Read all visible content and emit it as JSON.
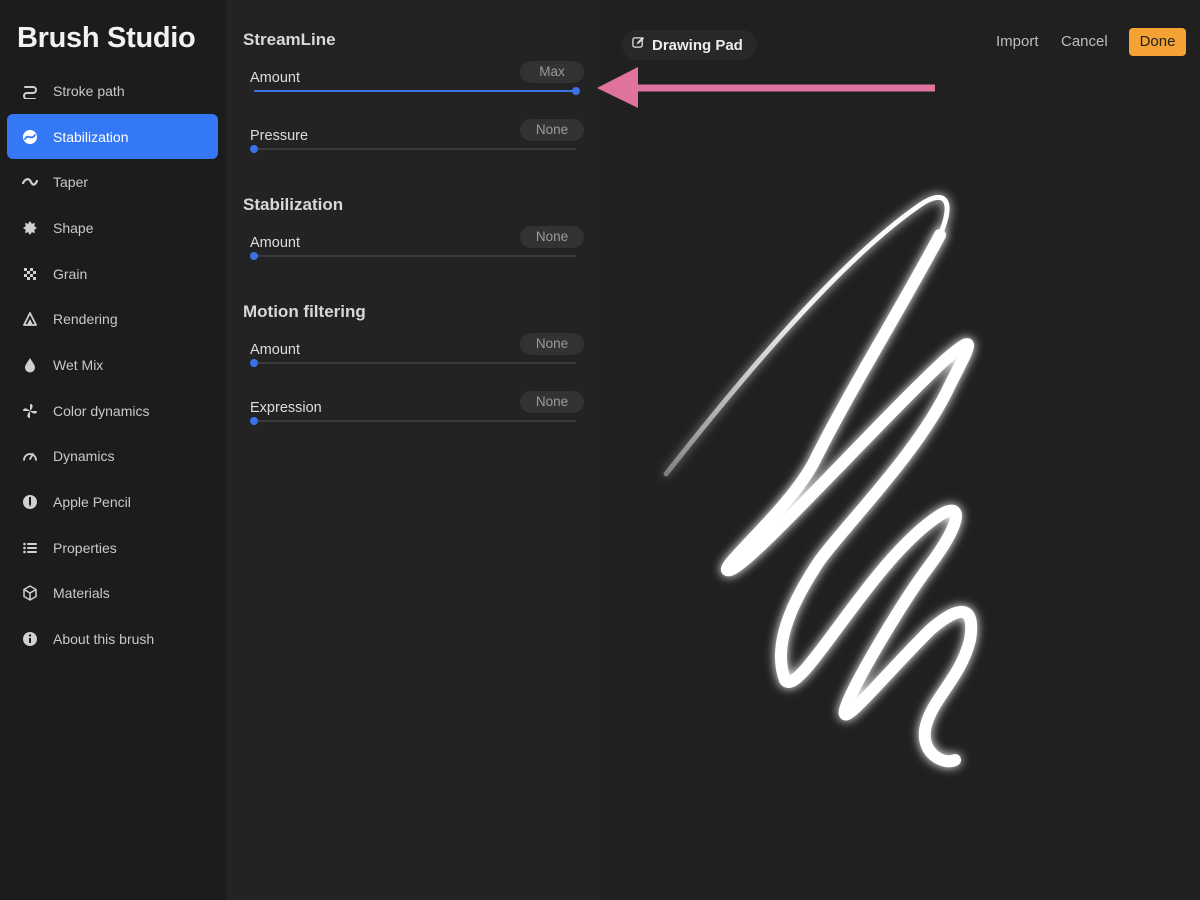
{
  "app": {
    "title": "Brush Studio"
  },
  "sidebar": {
    "items": [
      {
        "label": "Stroke path",
        "icon": "stroke-path-icon",
        "active": false
      },
      {
        "label": "Stabilization",
        "icon": "stabilization-icon",
        "active": true
      },
      {
        "label": "Taper",
        "icon": "taper-icon",
        "active": false
      },
      {
        "label": "Shape",
        "icon": "shape-icon",
        "active": false
      },
      {
        "label": "Grain",
        "icon": "grain-icon",
        "active": false
      },
      {
        "label": "Rendering",
        "icon": "rendering-icon",
        "active": false
      },
      {
        "label": "Wet Mix",
        "icon": "wet-mix-icon",
        "active": false
      },
      {
        "label": "Color dynamics",
        "icon": "color-dynamics-icon",
        "active": false
      },
      {
        "label": "Dynamics",
        "icon": "dynamics-icon",
        "active": false
      },
      {
        "label": "Apple Pencil",
        "icon": "apple-pencil-icon",
        "active": false
      },
      {
        "label": "Properties",
        "icon": "properties-icon",
        "active": false
      },
      {
        "label": "Materials",
        "icon": "materials-icon",
        "active": false
      },
      {
        "label": "About this brush",
        "icon": "about-icon",
        "active": false
      }
    ]
  },
  "panel": {
    "streamline": {
      "title": "StreamLine",
      "amount": {
        "label": "Amount",
        "value_text": "Max",
        "level": 1.0
      },
      "pressure": {
        "label": "Pressure",
        "value_text": "None",
        "level": 0.0
      }
    },
    "stabilization": {
      "title": "Stabilization",
      "amount": {
        "label": "Amount",
        "value_text": "None",
        "level": 0.0
      }
    },
    "motion_filtering": {
      "title": "Motion filtering",
      "amount": {
        "label": "Amount",
        "value_text": "None",
        "level": 0.0
      },
      "expression": {
        "label": "Expression",
        "value_text": "None",
        "level": 0.0
      }
    }
  },
  "pad": {
    "title": "Drawing Pad",
    "title_icon": "edit-icon",
    "import_label": "Import",
    "cancel_label": "Cancel",
    "done_label": "Done"
  },
  "colors": {
    "accent": "#3478f6",
    "done": "#f3a233",
    "annotation_arrow": "#e0739e"
  }
}
